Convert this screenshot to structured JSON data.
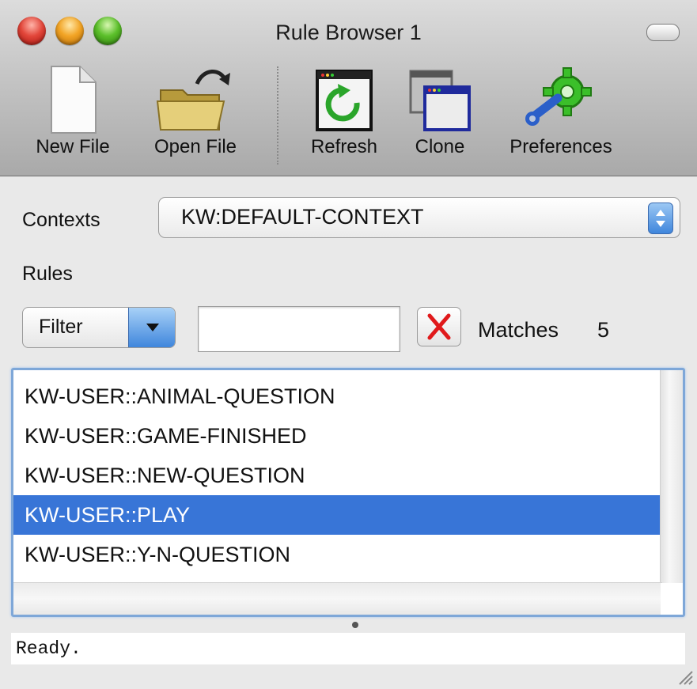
{
  "window": {
    "title": "Rule Browser 1"
  },
  "toolbar": {
    "items": [
      {
        "label": "New File",
        "icon": "document-icon"
      },
      {
        "label": "Open File",
        "icon": "folder-icon"
      },
      {
        "label": "Refresh",
        "icon": "refresh-icon"
      },
      {
        "label": "Clone",
        "icon": "clone-windows-icon"
      },
      {
        "label": "Preferences",
        "icon": "gear-wrench-icon"
      }
    ]
  },
  "contexts": {
    "label": "Contexts",
    "selected": "KW:DEFAULT-CONTEXT"
  },
  "rules": {
    "label": "Rules",
    "filter_label": "Filter",
    "search_value": "",
    "matches_label": "Matches",
    "matches_count": "5",
    "items": [
      {
        "text": "KW-USER::ANIMAL-QUESTION",
        "selected": false
      },
      {
        "text": "KW-USER::GAME-FINISHED",
        "selected": false
      },
      {
        "text": "KW-USER::NEW-QUESTION",
        "selected": false
      },
      {
        "text": "KW-USER::PLAY",
        "selected": true
      },
      {
        "text": "KW-USER::Y-N-QUESTION",
        "selected": false
      }
    ]
  },
  "status": {
    "text": "Ready."
  },
  "colors": {
    "selection": "#3875d7",
    "accent_blue": "#3f86dc",
    "clear_x": "#e0191b",
    "refresh_arrow": "#2aa52a"
  }
}
